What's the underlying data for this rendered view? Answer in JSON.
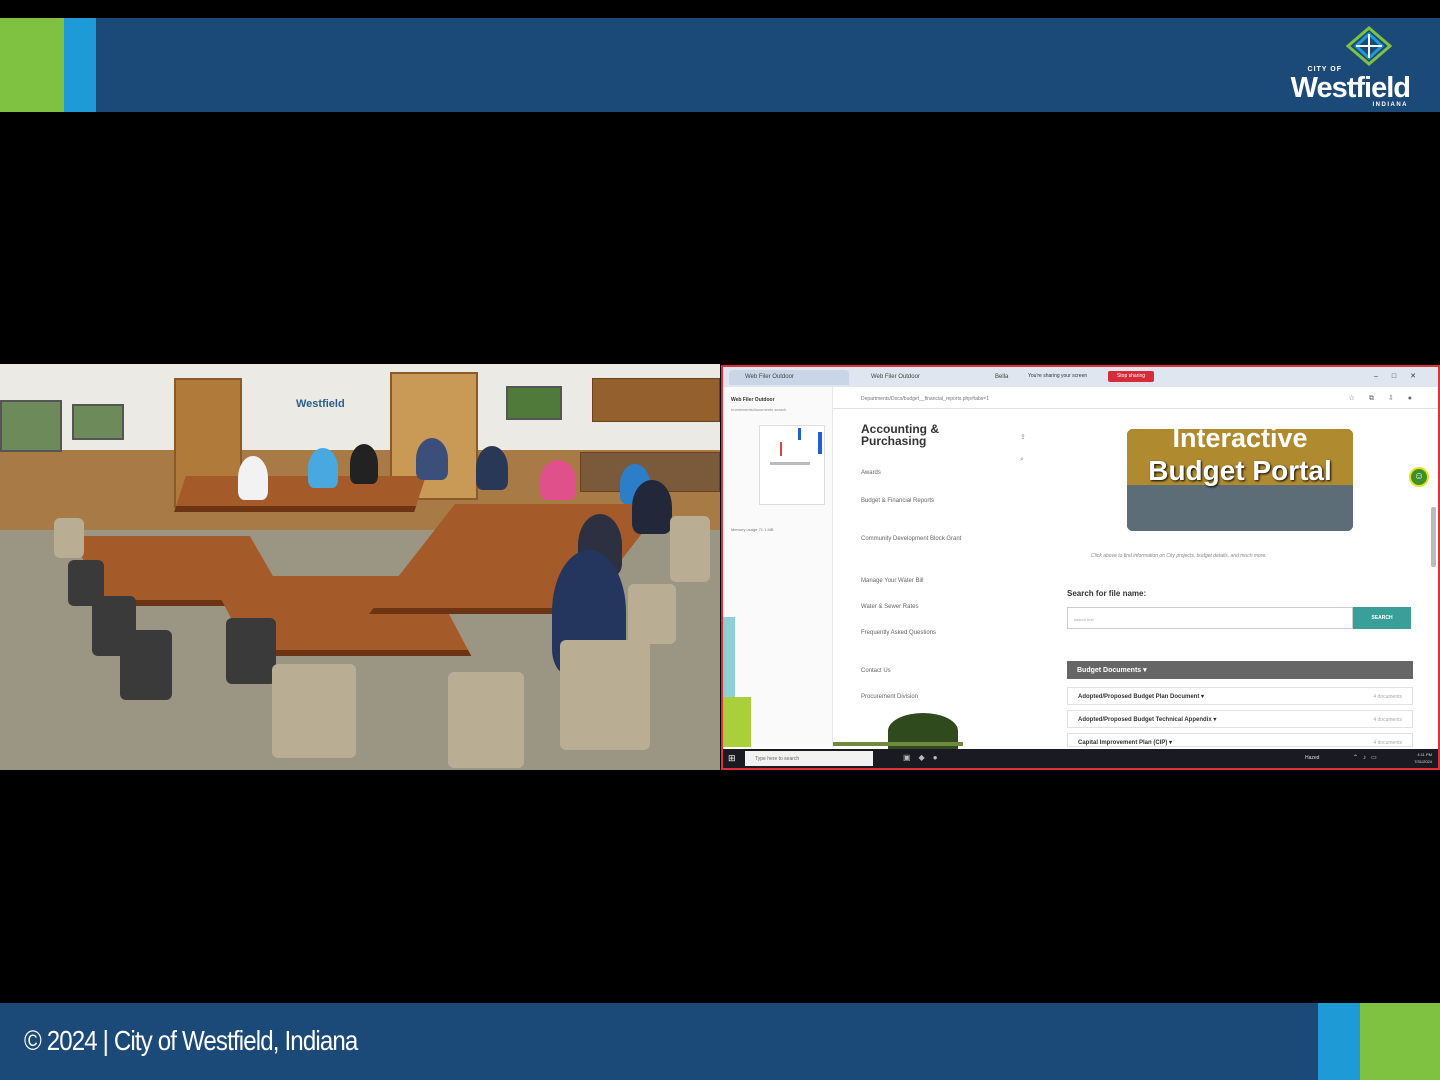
{
  "top_banner": {
    "logo": {
      "city_of": "CITY OF",
      "name": "Westfield",
      "state": "INDIANA"
    }
  },
  "bottom_banner": {
    "copyright": "© 2024 | City of Westfield, Indiana"
  },
  "camera": {
    "wall_sign": "Westfield"
  },
  "screen_share": {
    "browser": {
      "tabs": [
        "Web Filer Outdoor",
        "Web Filer Outdoor",
        "Bella"
      ],
      "sharing_note": "You're sharing your screen",
      "stop_sharing": "Stop sharing",
      "url": "Departments/Docs/budget__financial_reports.php#tabs=1"
    },
    "file_panel": {
      "title": "Web Filer Outdoor",
      "subtitle": "Investments/documents search",
      "size": "Memory usage 71.1 MB"
    },
    "nav": {
      "heading_line1": "Accounting &",
      "heading_line2": "Purchasing",
      "links": [
        "Awards",
        "Budget & Financial Reports",
        "Community Development Block Grant",
        "Manage Your Water Bill",
        "Water & Sewer Rates",
        "Frequently Asked Questions",
        "Contact Us",
        "Procurement Division"
      ]
    },
    "hero": {
      "line1": "Interactive",
      "line2": "Budget Portal",
      "caption": "Click above to find information on City projects, budget details, and much more."
    },
    "search": {
      "label": "Search for file name:",
      "placeholder": "search text",
      "button": "SEARCH"
    },
    "documents": {
      "header": "Budget Documents",
      "rows": [
        {
          "name": "Adopted/Proposed Budget Plan Document",
          "count": "4 documents"
        },
        {
          "name": "Adopted/Proposed Budget Technical Appendix",
          "count": "4 documents"
        },
        {
          "name": "Capital Improvement Plan (CIP)",
          "count": "4 documents"
        }
      ]
    },
    "taskbar": {
      "search_placeholder": "Type here to search",
      "weather": "Hazed",
      "time": "4:11 PM",
      "date": "7/31/2024"
    }
  }
}
